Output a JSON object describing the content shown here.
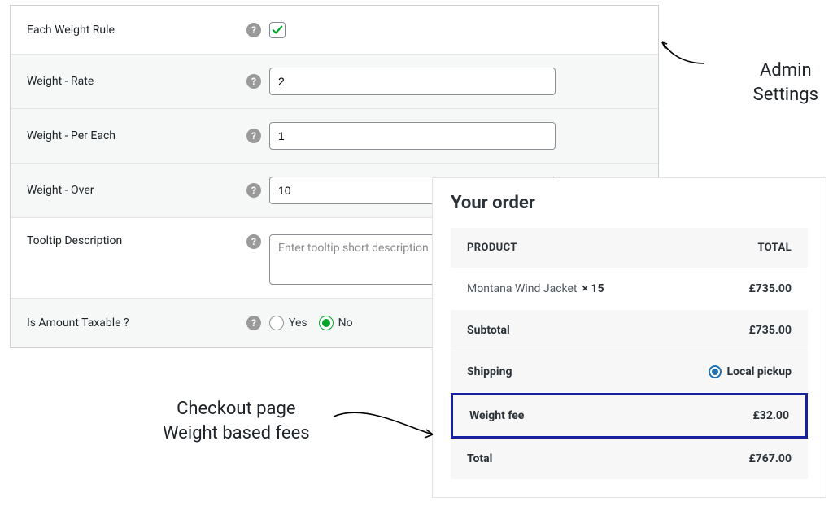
{
  "admin": {
    "rows": {
      "each_weight_rule": {
        "label": "Each Weight Rule",
        "checked": true
      },
      "weight_rate": {
        "label": "Weight - Rate",
        "value": "2"
      },
      "weight_per_each": {
        "label": "Weight - Per Each",
        "value": "1"
      },
      "weight_over": {
        "label": "Weight - Over",
        "value": "10"
      },
      "tooltip": {
        "label": "Tooltip Description",
        "placeholder": "Enter tooltip short description"
      },
      "taxable": {
        "label": "Is Amount Taxable ?",
        "yes": "Yes",
        "no": "No",
        "selected": "no"
      }
    }
  },
  "order": {
    "title": "Your order",
    "header_product": "PRODUCT",
    "header_total": "TOTAL",
    "product_name": "Montana Wind Jacket",
    "product_qty": "× 15",
    "product_total": "£735.00",
    "subtotal_label": "Subtotal",
    "subtotal_value": "£735.00",
    "shipping_label": "Shipping",
    "shipping_option": "Local pickup",
    "fee_label": "Weight fee",
    "fee_value": "£32.00",
    "total_label": "Total",
    "total_value": "£767.00"
  },
  "annotations": {
    "admin": "Admin\nSettings",
    "checkout": "Checkout page\nWeight based fees"
  }
}
